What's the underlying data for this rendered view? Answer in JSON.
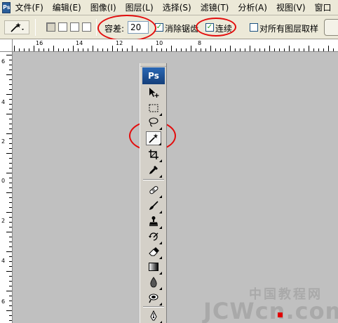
{
  "menubar": {
    "logo": "Ps",
    "items": [
      {
        "label": "文件(F)"
      },
      {
        "label": "编辑(E)"
      },
      {
        "label": "图像(I)"
      },
      {
        "label": "图层(L)"
      },
      {
        "label": "选择(S)"
      },
      {
        "label": "滤镜(T)"
      },
      {
        "label": "分析(A)"
      },
      {
        "label": "视图(V)"
      },
      {
        "label": "窗口"
      }
    ]
  },
  "options": {
    "tolerance_label": "容差:",
    "tolerance_value": "20",
    "antialias_label": "消除锯齿",
    "antialias_checked": "✓",
    "contiguous_label": "连续",
    "contiguous_checked": "✓",
    "sample_all_label": "对所有图层取样",
    "sample_all_checked": ""
  },
  "ruler": {
    "h_labels": [
      "16",
      "14",
      "12",
      "10",
      "8"
    ],
    "v_labels": [
      "6",
      "4",
      "2",
      "0",
      "2",
      "4",
      "6"
    ]
  },
  "toolbox": {
    "logo": "Ps",
    "tools": [
      {
        "name": "move-tool-icon"
      },
      {
        "name": "rectangular-marquee-tool-icon"
      },
      {
        "name": "lasso-tool-icon"
      },
      {
        "name": "magic-wand-tool-icon",
        "active": true
      },
      {
        "name": "crop-tool-icon"
      },
      {
        "name": "eyedropper-tool-icon"
      },
      {
        "name": "healing-brush-tool-icon"
      },
      {
        "name": "brush-tool-icon"
      },
      {
        "name": "clone-stamp-tool-icon"
      },
      {
        "name": "history-brush-tool-icon"
      },
      {
        "name": "eraser-tool-icon"
      },
      {
        "name": "gradient-tool-icon"
      },
      {
        "name": "blur-tool-icon"
      },
      {
        "name": "dodge-tool-icon"
      },
      {
        "name": "pen-tool-icon"
      }
    ]
  },
  "annotation_color": "#e30c0c",
  "watermark": {
    "chinese": "中国教程网",
    "latin": "JCWcn.com"
  }
}
